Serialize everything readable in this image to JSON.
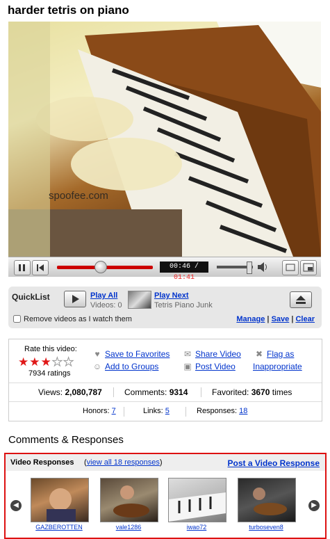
{
  "title": "harder tetris on piano",
  "video": {
    "watermark": "spoofee.com",
    "current_time": "00:46",
    "separator": " / ",
    "total_time": "01:41"
  },
  "quicklist": {
    "title": "QuickList",
    "play_all": "Play All",
    "videos_count": "Videos: 0",
    "play_next": "Play Next",
    "next_title": "Tetris Piano Junk",
    "remove_label": "Remove videos as I watch them",
    "manage": "Manage",
    "save": "Save",
    "clear": "Clear",
    "link_sep": " | "
  },
  "rating": {
    "label": "Rate this video:",
    "stars_filled": 3,
    "stars_total": 5,
    "ratings": "7934 ratings"
  },
  "actions": {
    "save_favorites": "Save to Favorites",
    "add_groups": "Add to Groups",
    "share_video": "Share Video",
    "post_video": "Post Video",
    "flag_as": "Flag as",
    "inappropriate": "Inappropriate"
  },
  "stats": {
    "views_label": "Views: ",
    "views": "2,080,787",
    "comments_label": "Comments: ",
    "comments": "9314",
    "favorited_label": "Favorited: ",
    "favorited": "3670",
    "favorited_suffix": " times",
    "honors_label": "Honors: ",
    "honors": "7",
    "links_label": "Links: ",
    "links": "5",
    "responses_label": "Responses: ",
    "responses": "18"
  },
  "comments_title": "Comments & Responses",
  "responses": {
    "title": "Video Responses",
    "view_all": "(view all 18 responses)",
    "view_all_link": "view all 18 responses",
    "post": "Post a Video Response",
    "items": [
      {
        "user": "GAZBEROTTEN"
      },
      {
        "user": "vale1286"
      },
      {
        "user": "iwao72"
      },
      {
        "user": "turboseven8"
      }
    ]
  },
  "colors": {
    "link": "#0033cc",
    "star": "#e01818",
    "progress": "#cc0000",
    "highlight_border": "#dd1111"
  }
}
